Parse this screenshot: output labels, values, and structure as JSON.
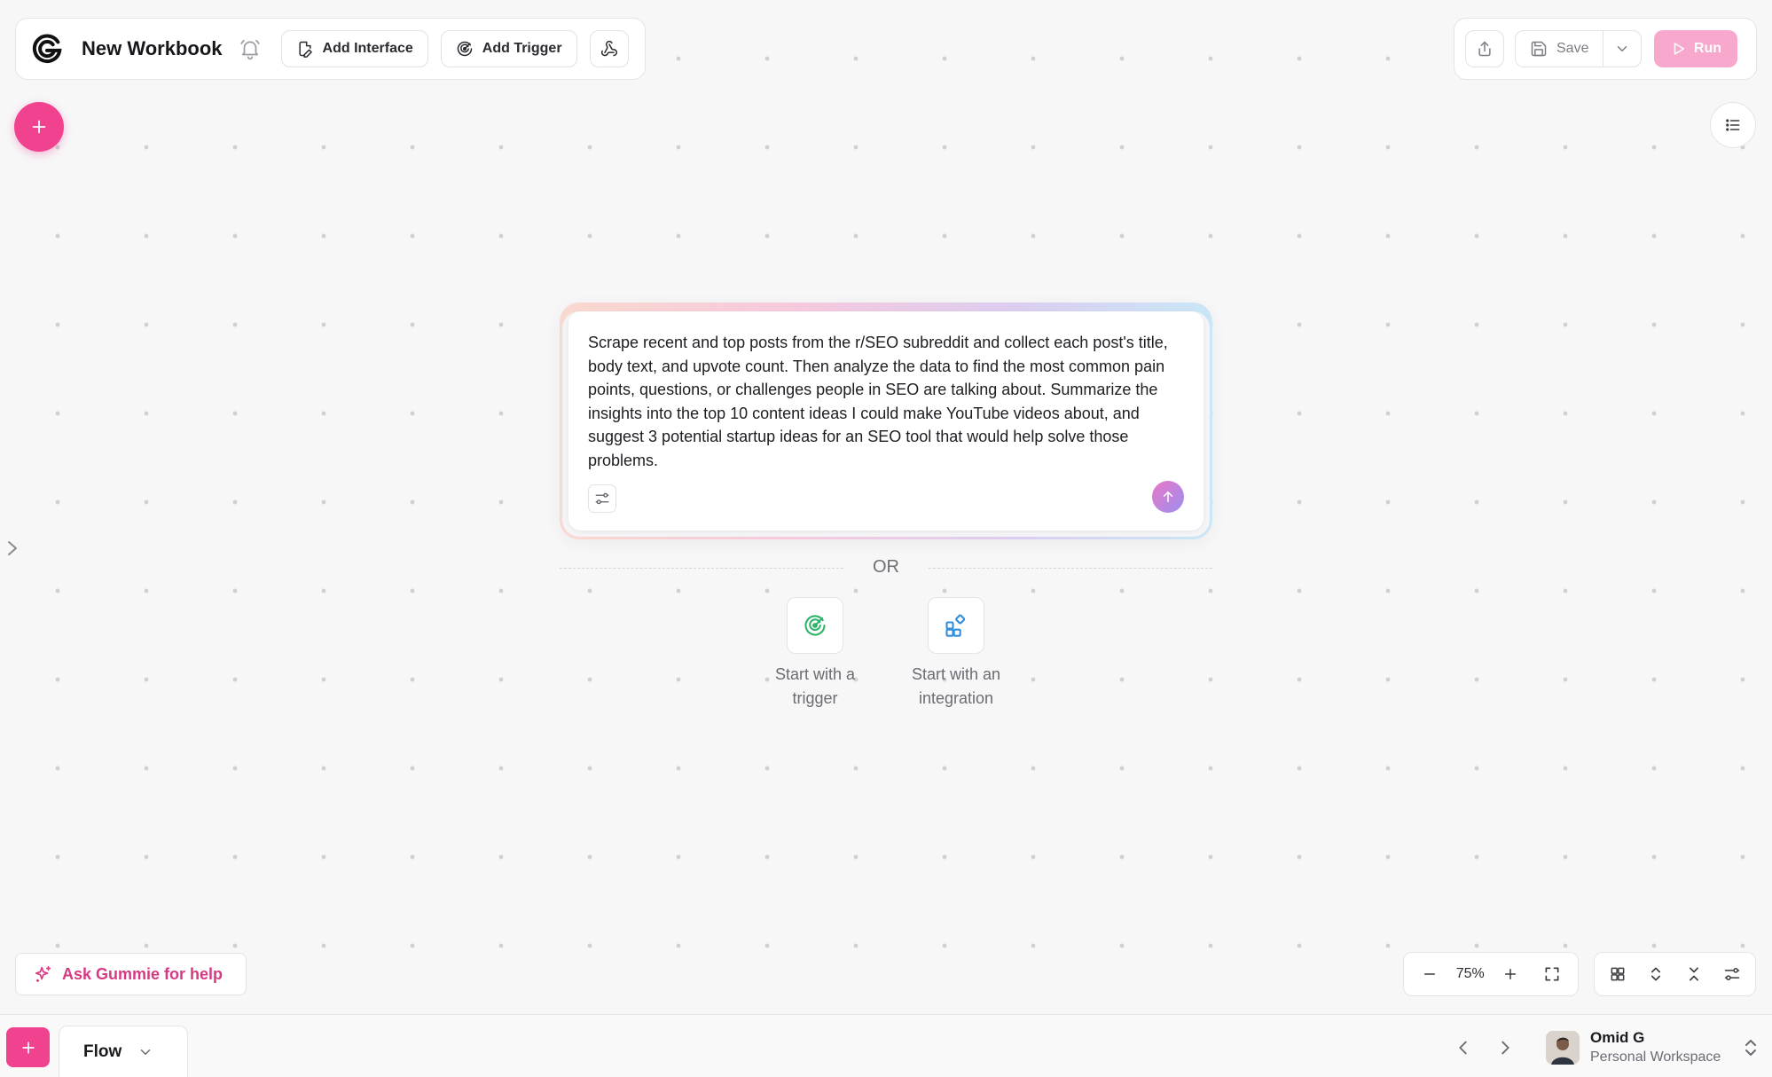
{
  "workbook": {
    "title": "New Workbook"
  },
  "toolbar": {
    "add_interface": "Add Interface",
    "add_trigger": "Add Trigger",
    "save": "Save",
    "run": "Run"
  },
  "prompt": {
    "text": "Scrape recent and top posts from the r/SEO subreddit and collect each post's title, body text, and upvote count. Then analyze the data to find the most common pain points, questions, or challenges people in SEO are talking about. Summarize the insights into the top 10 content ideas I could make YouTube videos about, and suggest 3 potential startup ideas for an SEO tool that would help solve those problems."
  },
  "divider": {
    "or": "OR"
  },
  "start_options": [
    {
      "label_line1": "Start with a",
      "label_line2": "trigger",
      "icon": "trigger-icon"
    },
    {
      "label_line1": "Start with an",
      "label_line2": "integration",
      "icon": "integration-icon"
    }
  ],
  "help": {
    "ask": "Ask Gummie for help"
  },
  "zoom": {
    "level": "75%"
  },
  "bottom": {
    "tab": "Flow"
  },
  "user": {
    "name": "Omid G",
    "workspace": "Personal Workspace"
  },
  "colors": {
    "accent": "#f0428e",
    "run_disabled": "#f7a8cc",
    "trigger_green": "#2fb36a",
    "integration_blue": "#2f8fdc"
  }
}
